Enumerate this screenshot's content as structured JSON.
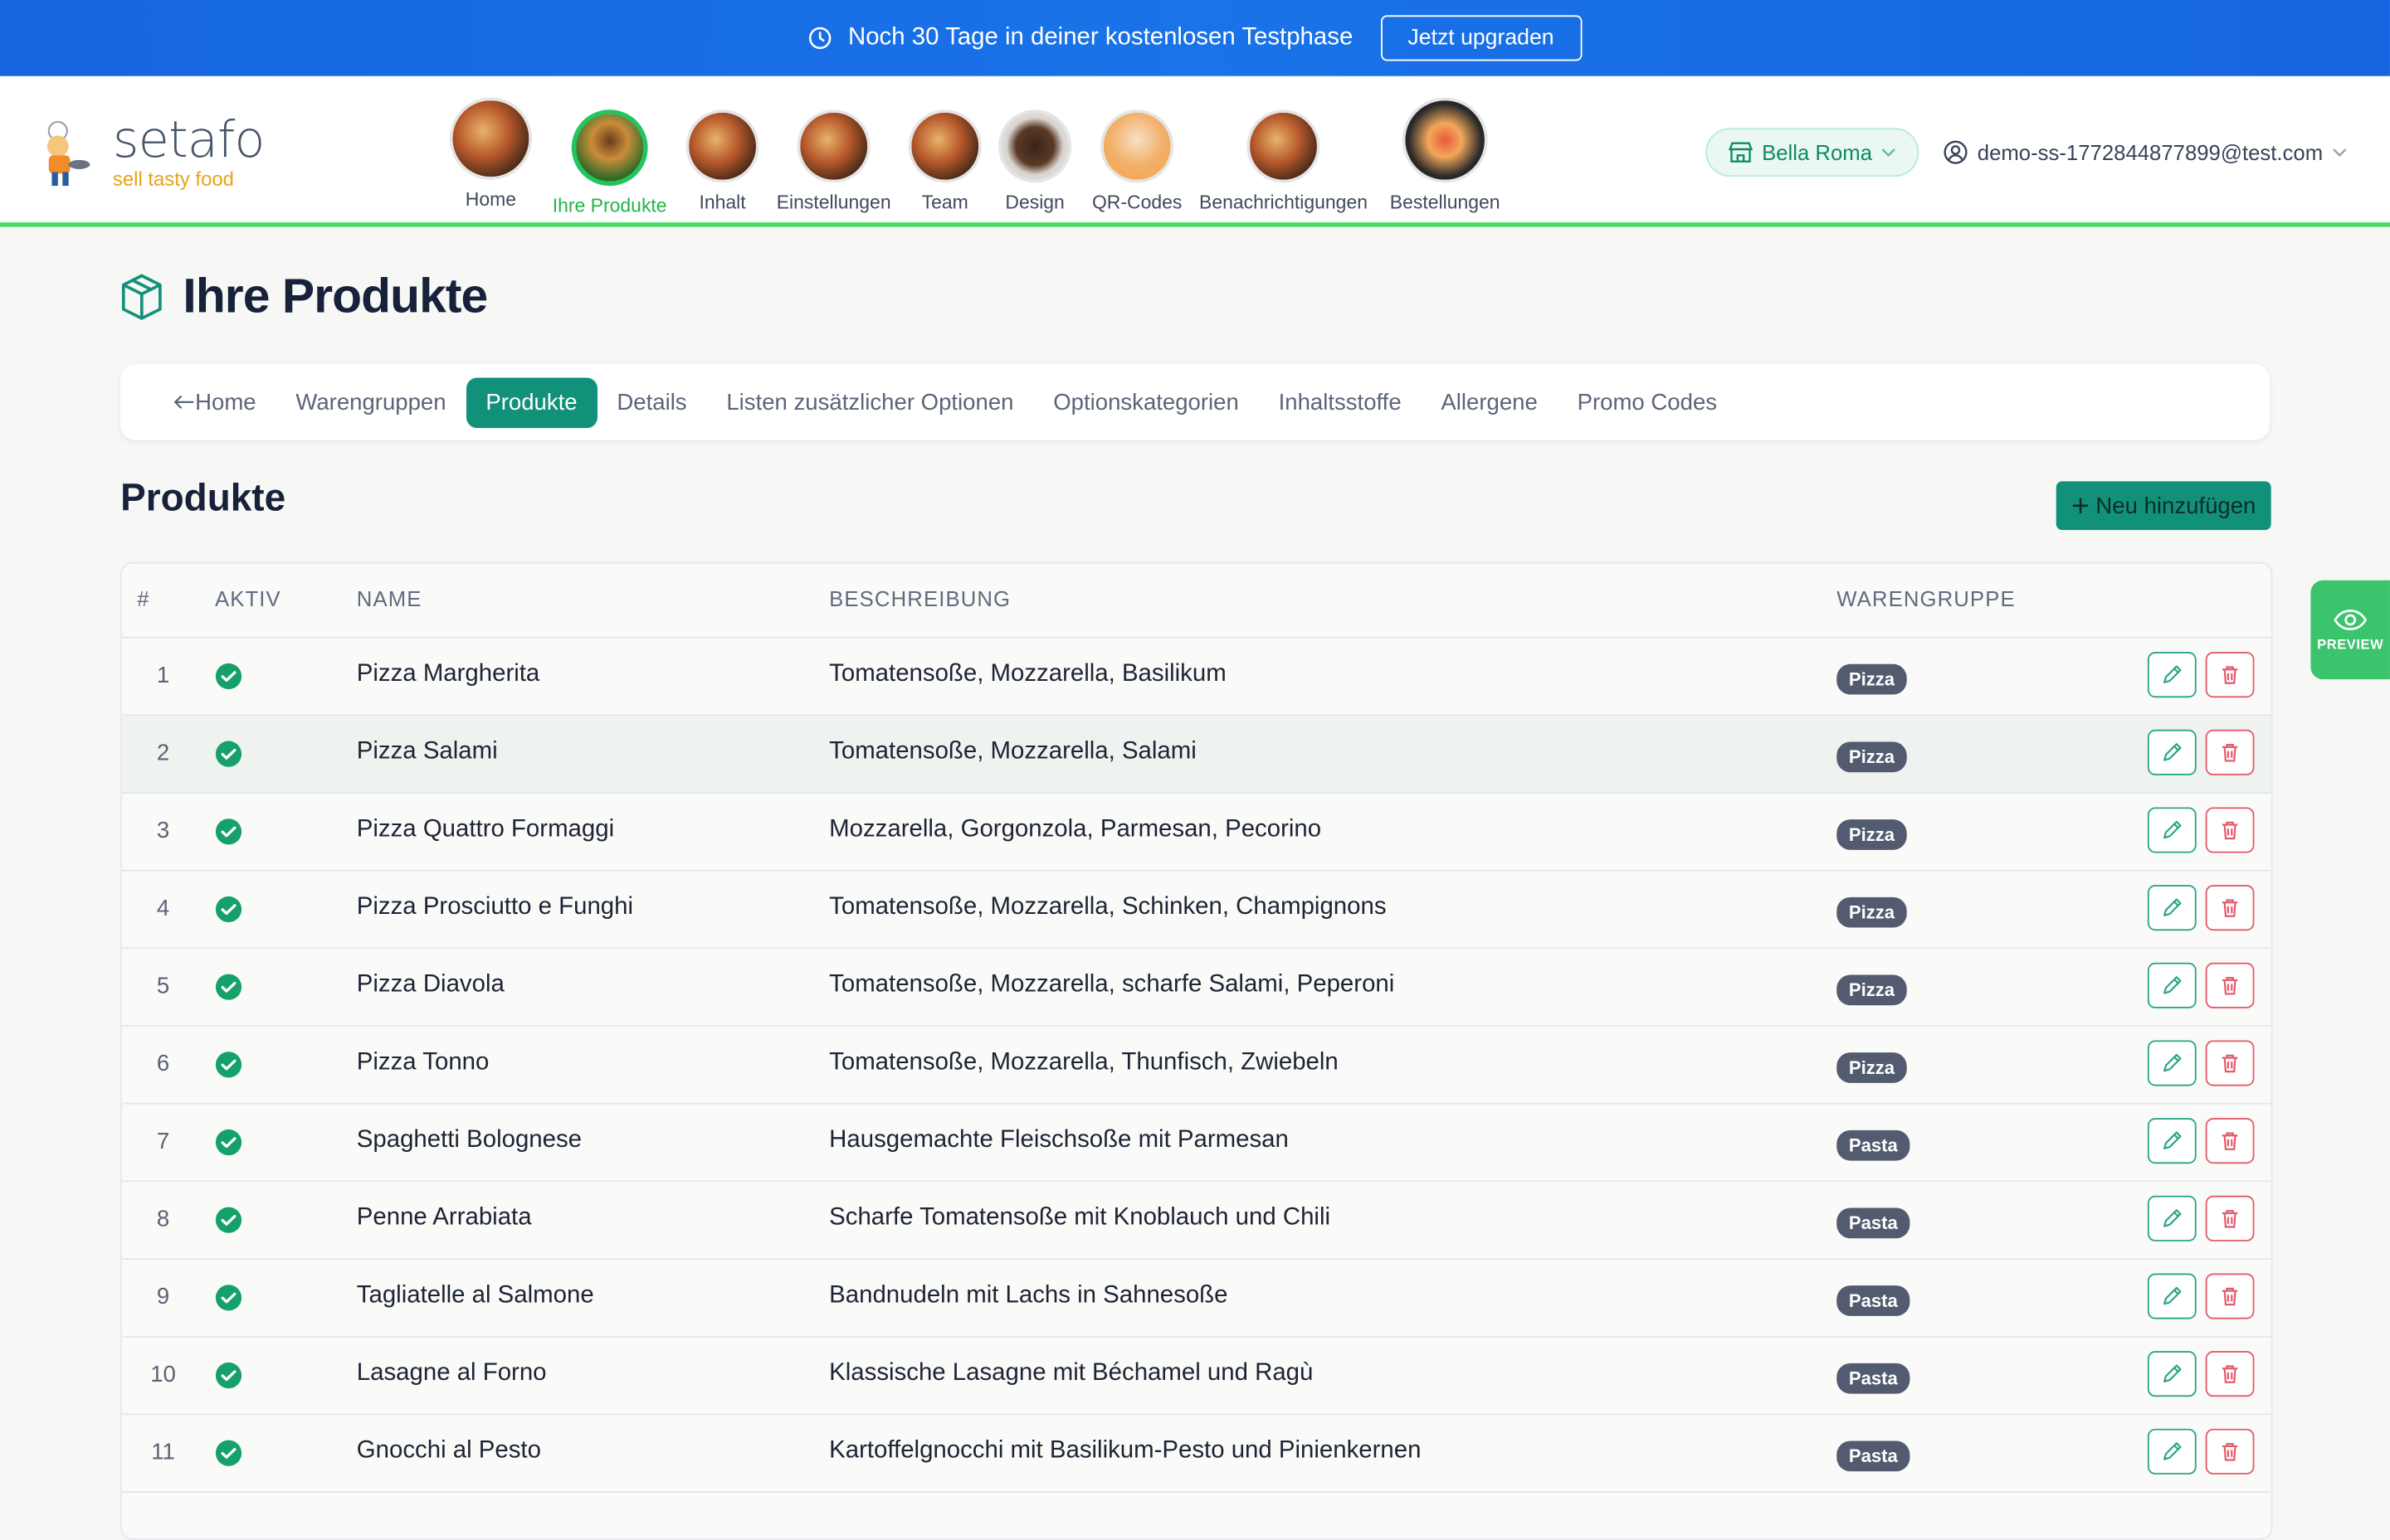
{
  "banner": {
    "text": "Noch 30 Tage in deiner kostenlosen Testphase",
    "button": "Jetzt upgraden"
  },
  "logo": {
    "name": "setafo",
    "tagline": "sell tasty food"
  },
  "nav": [
    {
      "label": "Home",
      "active": false
    },
    {
      "label": "Ihre Produkte",
      "active": true
    },
    {
      "label": "Inhalt",
      "active": false
    },
    {
      "label": "Einstellungen",
      "active": false
    },
    {
      "label": "Team",
      "active": false
    },
    {
      "label": "Design",
      "active": false
    },
    {
      "label": "QR-Codes",
      "active": false
    },
    {
      "label": "Benachrichtigungen",
      "active": false
    },
    {
      "label": "Bestellungen",
      "active": false
    }
  ],
  "store": "Bella Roma",
  "user": "demo-ss-1772844877899@test.com",
  "page_title": "Ihre Produkte",
  "tabs": [
    {
      "label": "Home"
    },
    {
      "label": "Warengruppen"
    },
    {
      "label": "Produkte",
      "active": true
    },
    {
      "label": "Details"
    },
    {
      "label": "Listen zusätzlicher Optionen"
    },
    {
      "label": "Optionskategorien"
    },
    {
      "label": "Inhaltsstoffe"
    },
    {
      "label": "Allergene"
    },
    {
      "label": "Promo Codes"
    }
  ],
  "section_title": "Produkte",
  "add_button": "Neu hinzufügen",
  "preview_label": "PREVIEW",
  "table": {
    "headers": {
      "num": "#",
      "active": "AKTIV",
      "name": "NAME",
      "desc": "BESCHREIBUNG",
      "group": "WARENGRUPPE"
    },
    "rows": [
      {
        "num": "1",
        "name": "Pizza Margherita",
        "desc": "Tomatensoße, Mozzarella, Basilikum",
        "group": "Pizza"
      },
      {
        "num": "2",
        "name": "Pizza Salami",
        "desc": "Tomatensoße, Mozzarella, Salami",
        "group": "Pizza"
      },
      {
        "num": "3",
        "name": "Pizza Quattro Formaggi",
        "desc": "Mozzarella, Gorgonzola, Parmesan, Pecorino",
        "group": "Pizza"
      },
      {
        "num": "4",
        "name": "Pizza Prosciutto e Funghi",
        "desc": "Tomatensoße, Mozzarella, Schinken, Champignons",
        "group": "Pizza"
      },
      {
        "num": "5",
        "name": "Pizza Diavola",
        "desc": "Tomatensoße, Mozzarella, scharfe Salami, Peperoni",
        "group": "Pizza"
      },
      {
        "num": "6",
        "name": "Pizza Tonno",
        "desc": "Tomatensoße, Mozzarella, Thunfisch, Zwiebeln",
        "group": "Pizza"
      },
      {
        "num": "7",
        "name": "Spaghetti Bolognese",
        "desc": "Hausgemachte Fleischsoße mit Parmesan",
        "group": "Pasta"
      },
      {
        "num": "8",
        "name": "Penne Arrabiata",
        "desc": "Scharfe Tomatensoße mit Knoblauch und Chili",
        "group": "Pasta"
      },
      {
        "num": "9",
        "name": "Tagliatelle al Salmone",
        "desc": "Bandnudeln mit Lachs in Sahnesoße",
        "group": "Pasta"
      },
      {
        "num": "10",
        "name": "Lasagne al Forno",
        "desc": "Klassische Lasagne mit Béchamel und Ragù",
        "group": "Pasta"
      },
      {
        "num": "11",
        "name": "Gnocchi al Pesto",
        "desc": "Kartoffelgnocchi mit Basilikum-Pesto und Pinienkernen",
        "group": "Pasta"
      }
    ]
  },
  "colors": {
    "banner": "#1a73e8",
    "accent": "#11917a",
    "active_nav": "#22c55e",
    "badge": "#525b6f",
    "delete": "#e45a6a"
  }
}
